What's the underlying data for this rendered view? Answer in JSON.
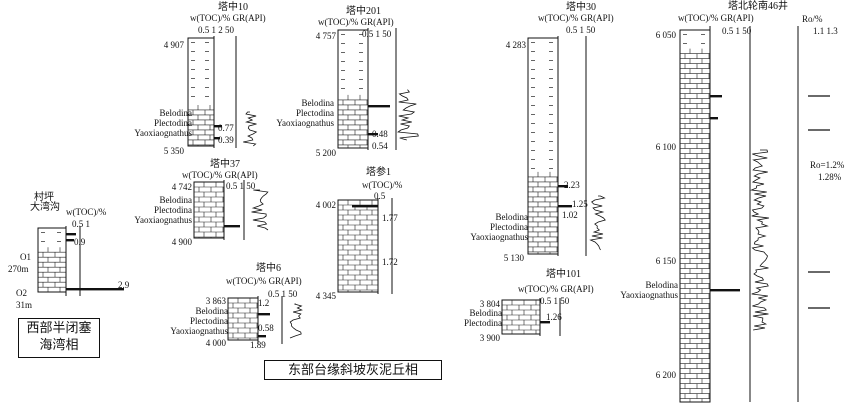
{
  "wells": [
    {
      "key": "tz10",
      "title": "塔中10",
      "header": "w(TOC)/% GR(API)",
      "scale": "0.5 1 2  50",
      "depth_top": "4 907",
      "depth_bottom": "5 350",
      "fossils": [
        "Belodina",
        "Plectodina",
        "Yaoxiaognathus"
      ],
      "values": [
        "0.77",
        "0.39"
      ]
    },
    {
      "key": "tz201",
      "title": "塔中201",
      "header": "w(TOC)/% GR(API)",
      "scale": "0.5 1  50",
      "depth_top": "4 757",
      "depth_bottom": "5 200",
      "fossils": [
        "Belodina",
        "Plectodina",
        "Yaoxiaognathus"
      ],
      "values": [
        "0.48",
        "0.54"
      ]
    },
    {
      "key": "tz30",
      "title": "塔中30",
      "header": "w(TOC)/% GR(API)",
      "scale": "0.5 1  50",
      "depth_top": "4 283",
      "depth_bottom": "5 130",
      "fossils": [
        "Belodina",
        "Plectodina",
        "Yaoxiaognathus"
      ],
      "values": [
        "2.23",
        "1.25",
        "1.02"
      ]
    },
    {
      "key": "tbl46",
      "title": "塔北轮南46井",
      "header": "w(TOC)/% GR(API)",
      "scale": "0.5  1  50",
      "ro_label": "Ro/%",
      "ro_scale": "1.1  1.3",
      "depths": [
        "6 050",
        "6 100",
        "6 150",
        "6 200"
      ],
      "fossils": [
        "Belodina",
        "Yaoxiaognathus"
      ],
      "ro_note_1": "Ro=1.2%",
      "ro_note_2": "1.28%"
    },
    {
      "key": "tz37",
      "title": "塔中37",
      "header": "w(TOC)/% GR(API)",
      "scale": "0.5 1  50",
      "depth_top": "4 742",
      "depth_bottom": "4 900",
      "fossils": [
        "Belodina",
        "Plectodina",
        "Yaoxiaognathus"
      ]
    },
    {
      "key": "tc1",
      "title": "塔参1",
      "header": "w(TOC)/%",
      "scale": "0.5",
      "depth_top": "4 002",
      "depth_bottom": "4 345",
      "values": [
        "1.77",
        "1.72"
      ]
    },
    {
      "key": "tz6",
      "title": "塔中6",
      "header": "w(TOC)/% GR(API)",
      "scale": "0.5 1  50",
      "depth_top": "3 863",
      "depth_bottom": "4 000",
      "fossils": [
        "Belodina",
        "Plectodina",
        "Yaoxiaognathus"
      ],
      "values": [
        "1.2",
        "0.58",
        "1.89"
      ]
    },
    {
      "key": "tz101",
      "title": "塔中101",
      "header": "w(TOC)/% GR(API)",
      "scale": "0.5 1  50",
      "depth_top": "3 804",
      "depth_bottom": "3 900",
      "fossils": [
        "Belodina",
        "Plectodina"
      ],
      "values": [
        "1.26"
      ]
    },
    {
      "key": "dwg",
      "title_1": "村坪",
      "title_2": "大湾沟",
      "header": "w(TOC)/%",
      "scale": "0.5 1",
      "units": [
        "O1",
        "270m",
        "O2",
        "31m"
      ],
      "values": [
        "0.9",
        "2.9"
      ]
    }
  ],
  "legend_west_1": "西部半闭塞",
  "legend_west_2": "海湾相",
  "legend_east": "东部台缘斜坡灰泥丘相"
}
